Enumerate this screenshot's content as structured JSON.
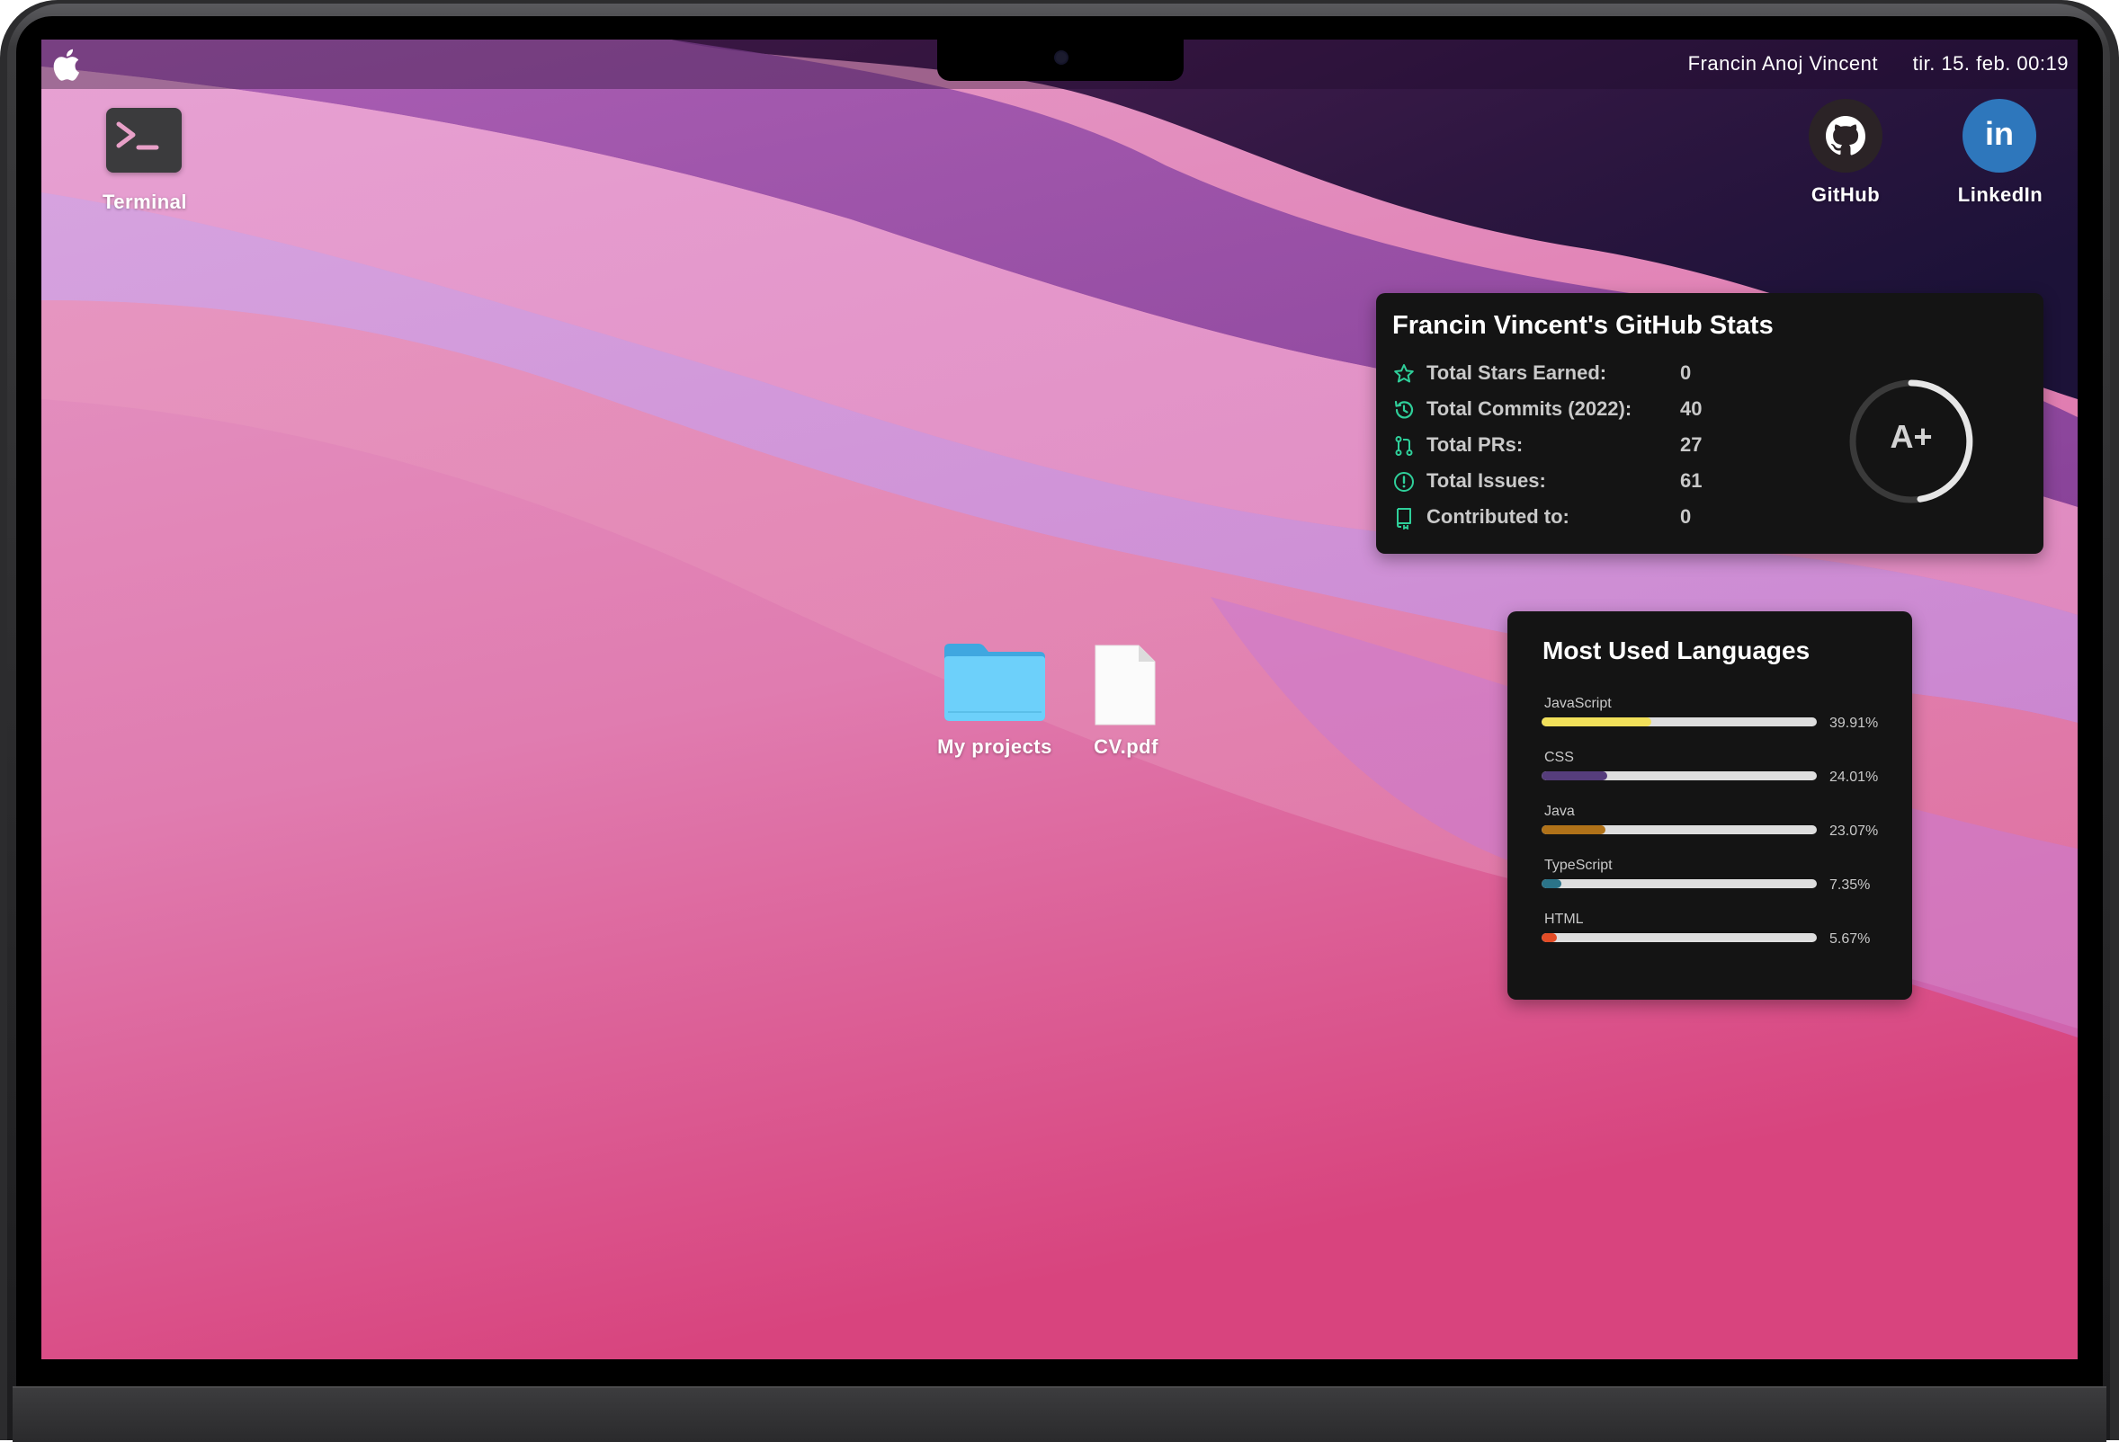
{
  "menubar": {
    "user_name": "Francin Anoj Vincent",
    "clock": "tir. 15. feb. 00:19"
  },
  "desktop": {
    "terminal_label": "Terminal",
    "github_label": "GitHub",
    "linkedin_label": "LinkedIn",
    "linkedin_glyph": "in",
    "folder_label": "My projects",
    "pdf_label": "CV.pdf"
  },
  "stats_card": {
    "title": "Francin Vincent's GitHub Stats",
    "rows": [
      {
        "icon": "star-icon",
        "label": "Total Stars Earned:",
        "value": "0"
      },
      {
        "icon": "history-icon",
        "label": "Total Commits (2022):",
        "value": "40"
      },
      {
        "icon": "pull-request-icon",
        "label": "Total PRs:",
        "value": "27"
      },
      {
        "icon": "issue-icon",
        "label": "Total Issues:",
        "value": "61"
      },
      {
        "icon": "repo-icon",
        "label": "Contributed to:",
        "value": "0"
      }
    ],
    "rank": "A+",
    "icon_color": "#2fcf9a"
  },
  "languages_card": {
    "title": "Most Used Languages",
    "languages": [
      {
        "name": "JavaScript",
        "percent_label": "39.91%",
        "percent": 39.91,
        "color": "#f1e05a"
      },
      {
        "name": "CSS",
        "percent_label": "24.01%",
        "percent": 24.01,
        "color": "#563d7c"
      },
      {
        "name": "Java",
        "percent_label": "23.07%",
        "percent": 23.07,
        "color": "#b07219"
      },
      {
        "name": "TypeScript",
        "percent_label": "7.35%",
        "percent": 7.35,
        "color": "#2b7489"
      },
      {
        "name": "HTML",
        "percent_label": "5.67%",
        "percent": 5.67,
        "color": "#e34c26"
      }
    ]
  }
}
